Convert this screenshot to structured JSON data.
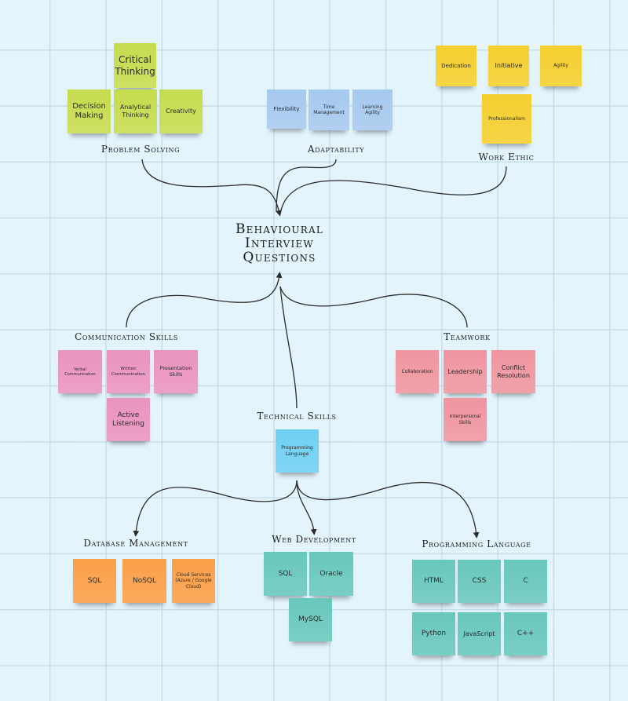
{
  "diagram": {
    "central_topic": [
      "Behavioural",
      "Interview",
      "Questions"
    ],
    "groups": {
      "problem_solving": {
        "label": "Problem Solving",
        "color": "#c6dc4e",
        "notes": [
          "Critical Thinking",
          "Decision Making",
          "Analytical Thinking",
          "Creativity"
        ]
      },
      "adaptability": {
        "label": "Adaptability",
        "color": "#a6c9ef",
        "notes": [
          "Flexibility",
          "Time Management",
          "Learning Agility"
        ]
      },
      "work_ethic": {
        "label": "Work Ethic",
        "color": "#f4cf2e",
        "notes": [
          "Dedication",
          "Initiative",
          "Agility",
          "Professionalism"
        ]
      },
      "communication_skills": {
        "label": "Communication Skills",
        "color": "#ea93c0",
        "notes": [
          "Verbal Communication",
          "Written Communication",
          "Presentation Skills",
          "Active Listening"
        ]
      },
      "teamwork": {
        "label": "Teamwork",
        "color": "#ef959f",
        "notes": [
          "Collaboration",
          "Leadership",
          "Conflict Resolution",
          "Interpersonal Skills"
        ]
      },
      "technical_skills": {
        "label": "Technical Skills",
        "color": "#6fd0f3",
        "notes": [
          "Programming Language"
        ]
      },
      "database_management": {
        "label": "Database Management",
        "color": "#fb9f48",
        "notes": [
          "SQL",
          "NoSQL",
          "Cloud Services (Azure / Google Cloud)"
        ]
      },
      "web_development": {
        "label": "Web Development",
        "color": "#68c7bc",
        "notes": [
          "SQL",
          "Oracle",
          "MySQL"
        ]
      },
      "programming_language": {
        "label": "Programming Language",
        "color": "#68c7bc",
        "notes": [
          "HTML",
          "CSS",
          "C",
          "Python",
          "JavaScript",
          "C++"
        ]
      }
    }
  }
}
